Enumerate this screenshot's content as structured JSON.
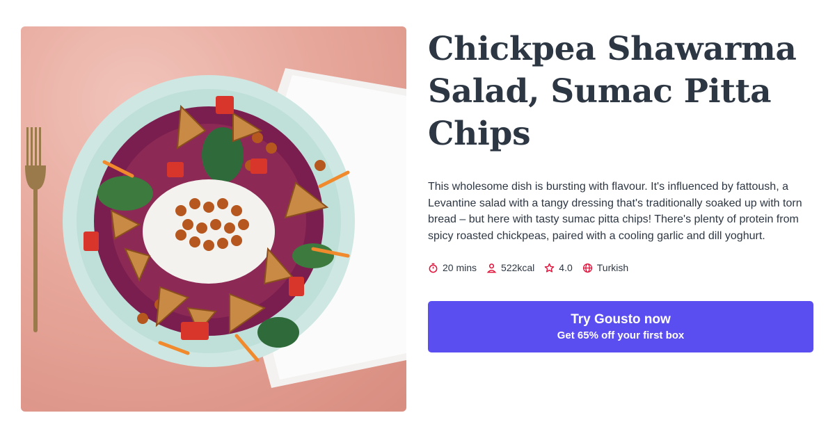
{
  "recipe": {
    "title": "Chickpea Shawarma Salad, Sumac Pitta Chips",
    "description": "This wholesome dish is bursting with flavour. It's influenced by fattoush, a Levantine salad with a tangy dressing that's traditionally soaked up with torn bread – but here with tasty sumac pitta chips! There's plenty of protein from spicy roasted chickpeas, paired with a cooling garlic and dill yoghurt.",
    "meta": {
      "time": "20 mins",
      "calories": "522kcal",
      "rating": "4.0",
      "cuisine": "Turkish"
    }
  },
  "cta": {
    "main_label": "Try Gousto now",
    "sub_label": "Get 65% off your first box"
  },
  "icons": {
    "time": "stopwatch-icon",
    "calories": "person-icon",
    "rating": "star-icon",
    "cuisine": "globe-icon"
  },
  "colors": {
    "accent": "#5b4ef0",
    "icon": "#e0123a",
    "text": "#2d3743"
  }
}
